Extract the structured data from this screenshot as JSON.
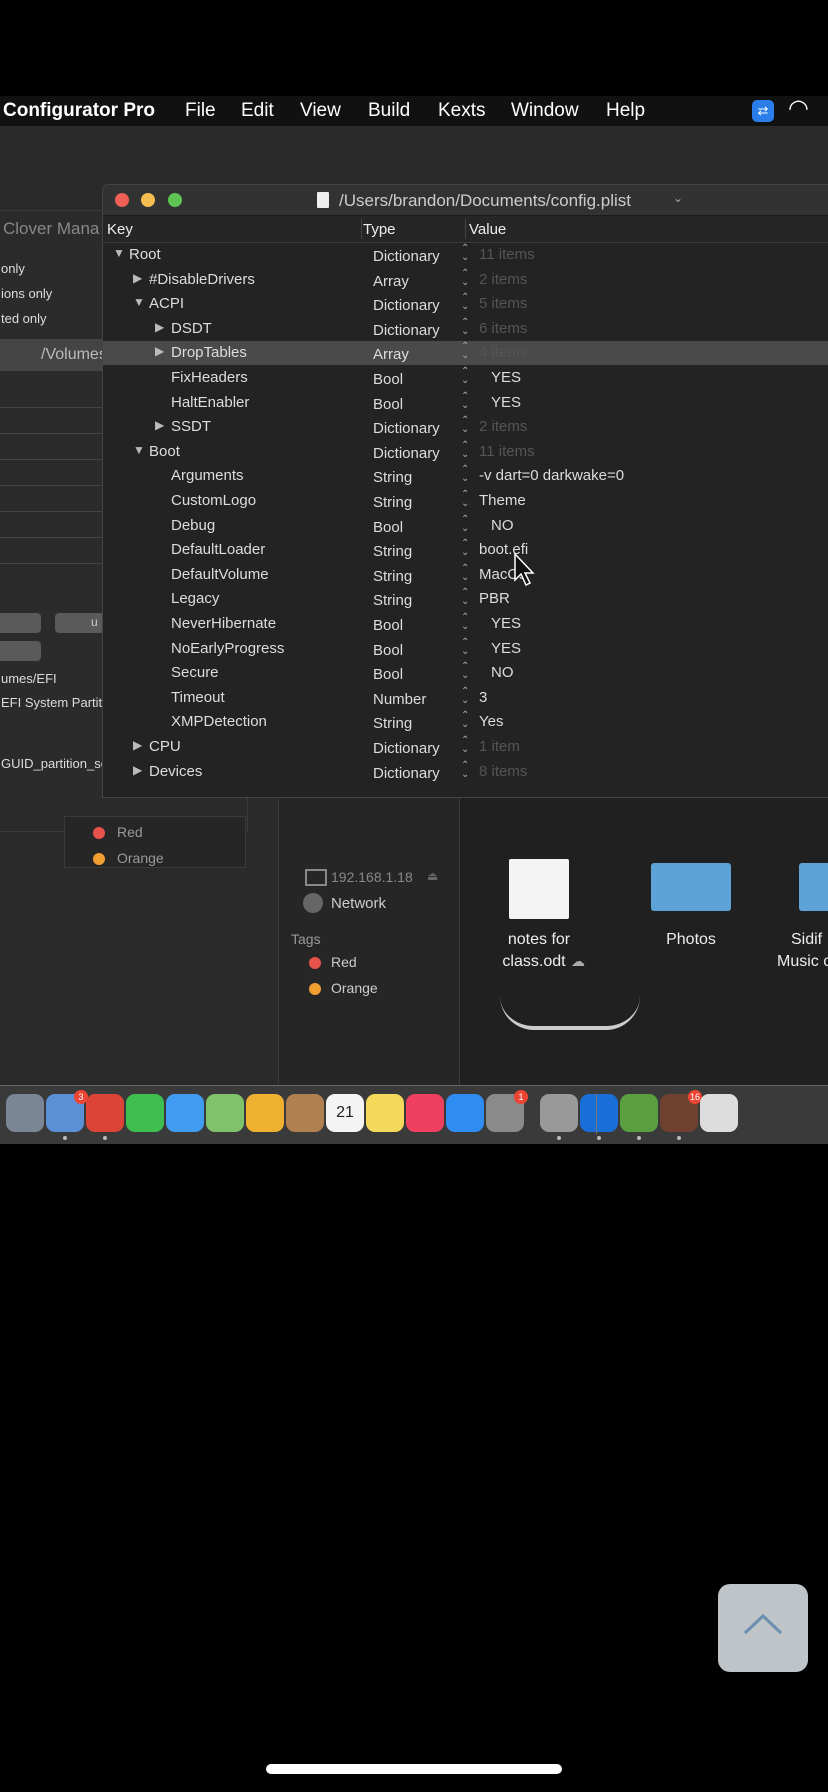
{
  "menubar": {
    "app_name": "Configurator Pro",
    "items": [
      "File",
      "Edit",
      "View",
      "Build",
      "Kexts",
      "Window",
      "Help"
    ]
  },
  "behind_window": {
    "title": "Clover Mana",
    "options": [
      "only",
      "ions only",
      "ted only"
    ],
    "path": "/Volumes",
    "button_label": "u",
    "info": [
      "umes/EFI",
      "EFI System Partiti",
      "GUID_partition_sc"
    ],
    "tags": [
      {
        "label": "Red",
        "color": "#e5534b"
      },
      {
        "label": "Orange",
        "color": "#f0a030"
      }
    ]
  },
  "finder": {
    "sidebar_ip": "192.168.1.18",
    "network": "Network",
    "tags_title": "Tags",
    "tags": [
      {
        "label": "Red",
        "color": "#e5534b"
      },
      {
        "label": "Orange",
        "color": "#f0a030"
      }
    ],
    "files": [
      {
        "label": "notes for",
        "label2": "class.odt"
      },
      {
        "label": "Photos"
      },
      {
        "label": "Sidif",
        "label2": "Music c"
      }
    ]
  },
  "plist_window": {
    "title": "/Users/brandon/Documents/config.plist",
    "columns": {
      "key": "Key",
      "type": "Type",
      "value": "Value"
    },
    "rows": [
      {
        "key": "Root",
        "type": "Dictionary",
        "value": "11 items",
        "level": 0,
        "expand": "open",
        "dim": true
      },
      {
        "key": "#DisableDrivers",
        "type": "Array",
        "value": "2 items",
        "level": 1,
        "expand": "closed",
        "dim": true
      },
      {
        "key": "ACPI",
        "type": "Dictionary",
        "value": "5 items",
        "level": 1,
        "expand": "open",
        "dim": true
      },
      {
        "key": "DSDT",
        "type": "Dictionary",
        "value": "6 items",
        "level": 2,
        "expand": "closed",
        "dim": true
      },
      {
        "key": "DropTables",
        "type": "Array",
        "value": "4 items",
        "level": 2,
        "expand": "closed",
        "dim": true,
        "selected": true
      },
      {
        "key": "FixHeaders",
        "type": "Bool",
        "value": "YES",
        "level": 2,
        "bool": true
      },
      {
        "key": "HaltEnabler",
        "type": "Bool",
        "value": "YES",
        "level": 2,
        "bool": true
      },
      {
        "key": "SSDT",
        "type": "Dictionary",
        "value": "2 items",
        "level": 2,
        "expand": "closed",
        "dim": true
      },
      {
        "key": "Boot",
        "type": "Dictionary",
        "value": "11 items",
        "level": 1,
        "expand": "open",
        "dim": true
      },
      {
        "key": "Arguments",
        "type": "String",
        "value": "-v dart=0 darkwake=0",
        "level": 2
      },
      {
        "key": "CustomLogo",
        "type": "String",
        "value": "Theme",
        "level": 2
      },
      {
        "key": "Debug",
        "type": "Bool",
        "value": "NO",
        "level": 2,
        "bool": true
      },
      {
        "key": "DefaultLoader",
        "type": "String",
        "value": "boot.efi",
        "level": 2
      },
      {
        "key": "DefaultVolume",
        "type": "String",
        "value": "MacOs",
        "level": 2
      },
      {
        "key": "Legacy",
        "type": "String",
        "value": "PBR",
        "level": 2
      },
      {
        "key": "NeverHibernate",
        "type": "Bool",
        "value": "YES",
        "level": 2,
        "bool": true
      },
      {
        "key": "NoEarlyProgress",
        "type": "Bool",
        "value": "YES",
        "level": 2,
        "bool": true
      },
      {
        "key": "Secure",
        "type": "Bool",
        "value": "NO",
        "level": 2,
        "bool": true
      },
      {
        "key": "Timeout",
        "type": "Number",
        "value": "3",
        "level": 2
      },
      {
        "key": "XMPDetection",
        "type": "String",
        "value": "Yes",
        "level": 2
      },
      {
        "key": "CPU",
        "type": "Dictionary",
        "value": "1 item",
        "level": 1,
        "expand": "closed",
        "dim": true
      },
      {
        "key": "Devices",
        "type": "Dictionary",
        "value": "8 items",
        "level": 1,
        "expand": "closed",
        "dim": true
      }
    ]
  },
  "dock": {
    "icons": [
      {
        "name": "launchpad-icon",
        "color": "#7a8696"
      },
      {
        "name": "mail-icon",
        "color": "#5b8fd6",
        "badge": "3",
        "dot": true
      },
      {
        "name": "chrome-icon",
        "color": "#db4437",
        "dot": true
      },
      {
        "name": "facetime-icon",
        "color": "#3fbf4f"
      },
      {
        "name": "messages-icon",
        "color": "#3f9cf0"
      },
      {
        "name": "maps-icon",
        "color": "#7fc26b"
      },
      {
        "name": "photos-icon",
        "color": "#f0b030"
      },
      {
        "name": "contacts-icon",
        "color": "#b08050"
      },
      {
        "name": "calendar-icon",
        "color": "#f4f4f4",
        "text": "21"
      },
      {
        "name": "notes-icon",
        "color": "#f5d95a"
      },
      {
        "name": "music-icon",
        "color": "#f04060"
      },
      {
        "name": "app-store-icon",
        "color": "#2f8cf0"
      },
      {
        "name": "system-preferences-icon",
        "color": "#8a8a8a",
        "badge": "1"
      },
      {
        "name": "disk-utility-icon",
        "color": "#999",
        "dot": true
      },
      {
        "name": "teamviewer-icon",
        "color": "#1a6ed8",
        "dot": true
      },
      {
        "name": "clover-icon",
        "color": "#5aa040",
        "dot": true
      },
      {
        "name": "crosshair-icon",
        "color": "#704030",
        "badge": "16",
        "dot": true
      },
      {
        "name": "finder-icon",
        "color": "#ddd"
      }
    ]
  },
  "scroll_top_button": {
    "icon": "chevron-up-icon"
  }
}
